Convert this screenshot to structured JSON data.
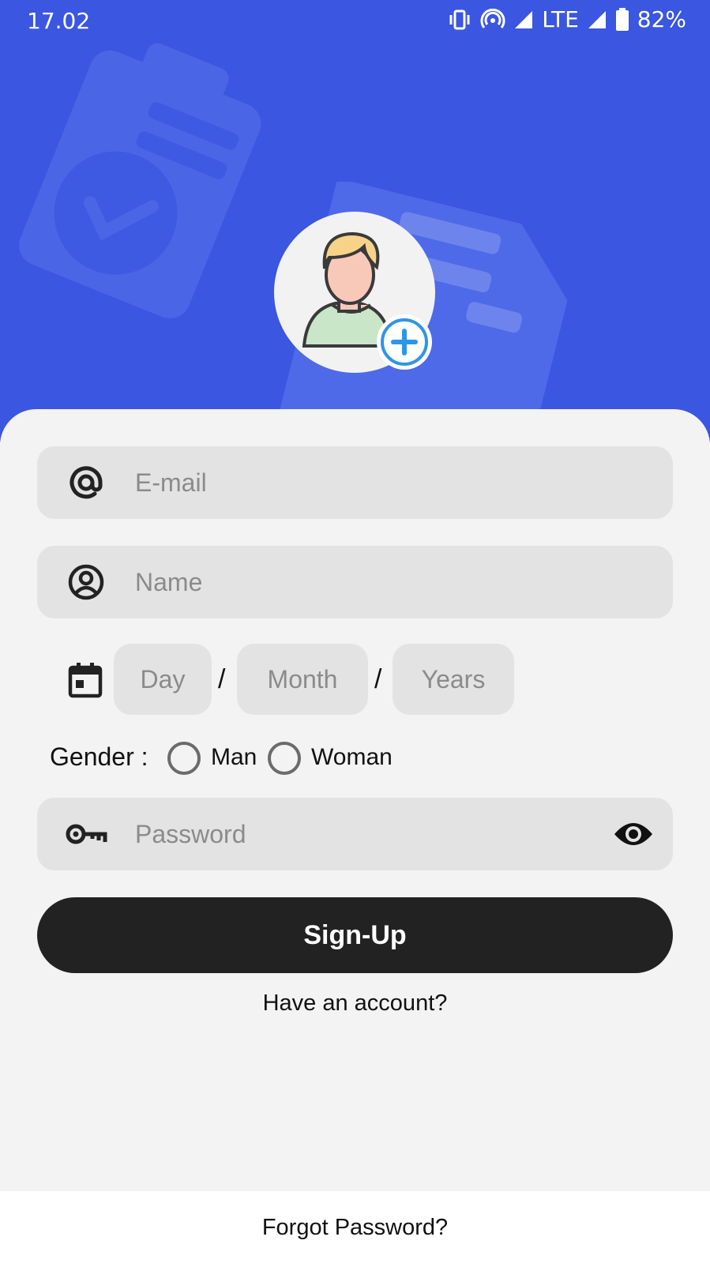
{
  "status_bar": {
    "time": "17.02",
    "network": "LTE",
    "battery": "82%"
  },
  "colors": {
    "header": "#3b56e0",
    "card": "#f3f3f3",
    "field": "#e3e3e3",
    "button": "#222222",
    "accent": "#2f95e6"
  },
  "avatar": {
    "icon": "user-avatar-icon",
    "action_icon": "add-circle-icon"
  },
  "form": {
    "email_placeholder": "E-mail",
    "name_placeholder": "Name",
    "dob": {
      "day_placeholder": "Day",
      "month_placeholder": "Month",
      "year_placeholder": "Years",
      "separator": "/"
    },
    "gender": {
      "label": "Gender :",
      "options": [
        "Man",
        "Woman"
      ]
    },
    "password_placeholder": "Password"
  },
  "actions": {
    "signup_label": "Sign-Up",
    "have_account_label": "Have an account?",
    "forgot_label": "Forgot Password?"
  }
}
